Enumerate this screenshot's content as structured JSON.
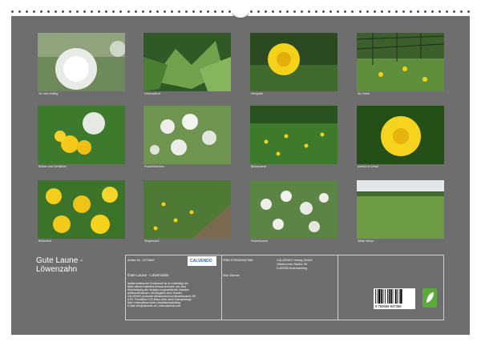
{
  "colors": {
    "page": "#6e6e6e",
    "text": "#ffffff",
    "accent": "#5aab3a"
  },
  "captions": [
    "Vor dem Abflug",
    "Löwenzähne",
    "Herrgarte",
    "Am Rand",
    "Blühen und Verblühen",
    "Pusteblümchen",
    "Blütenwiese",
    "perfekt im Detail",
    "Blütenfeld",
    "Wegesrand",
    "Pusteblumen",
    "Weite Wiese"
  ],
  "calendar": {
    "title": "Gute Laune - Löwenzahn",
    "article_label": "Artikel-Nr.: 2472862",
    "isbn": "ISBN 9783669947368",
    "publisher": [
      "CALVENDO Verlag GmbH",
      "Ottobrunner Straße 39",
      "D-82008 Unterhaching"
    ],
    "subtitle": "Gute Laune - Löwenzahn",
    "author": "Elke Werner",
    "legal": [
      "Inhalte bestehen/er Schutzrecht ist es unbeleidigt. die",
      "Bilder dieses Kalenders herauszunehmen und ohne",
      "Genehmigung des Verlages zu gewerblichen Zwecken",
      "weiterzuverwenden. Alle Angaben ohne Gewähr.",
      "CALVENDO produziert klimaneutral und klimabewusst in DE",
      "& EU. Produktion CO2-Bilanz aktiv durch Transportwege.",
      "Mehr Informationen beim Umweltschutzbeitrag.",
      "E-Mail: info@calvendo.de | www.calvendo.com"
    ],
    "barcode_number": "9 783669 947368",
    "logo_text": "CALVENDO"
  }
}
